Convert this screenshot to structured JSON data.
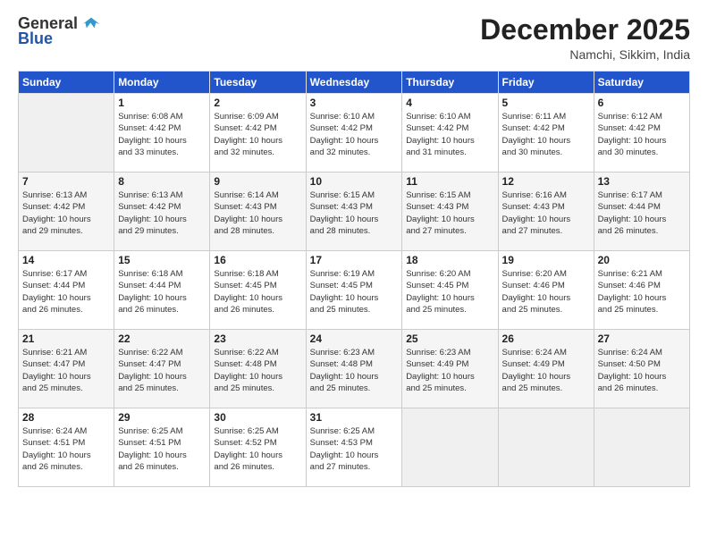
{
  "header": {
    "logo_general": "General",
    "logo_blue": "Blue",
    "month_title": "December 2025",
    "subtitle": "Namchi, Sikkim, India"
  },
  "days_of_week": [
    "Sunday",
    "Monday",
    "Tuesday",
    "Wednesday",
    "Thursday",
    "Friday",
    "Saturday"
  ],
  "weeks": [
    [
      {
        "day": "",
        "info": ""
      },
      {
        "day": "1",
        "info": "Sunrise: 6:08 AM\nSunset: 4:42 PM\nDaylight: 10 hours\nand 33 minutes."
      },
      {
        "day": "2",
        "info": "Sunrise: 6:09 AM\nSunset: 4:42 PM\nDaylight: 10 hours\nand 32 minutes."
      },
      {
        "day": "3",
        "info": "Sunrise: 6:10 AM\nSunset: 4:42 PM\nDaylight: 10 hours\nand 32 minutes."
      },
      {
        "day": "4",
        "info": "Sunrise: 6:10 AM\nSunset: 4:42 PM\nDaylight: 10 hours\nand 31 minutes."
      },
      {
        "day": "5",
        "info": "Sunrise: 6:11 AM\nSunset: 4:42 PM\nDaylight: 10 hours\nand 30 minutes."
      },
      {
        "day": "6",
        "info": "Sunrise: 6:12 AM\nSunset: 4:42 PM\nDaylight: 10 hours\nand 30 minutes."
      }
    ],
    [
      {
        "day": "7",
        "info": "Sunrise: 6:13 AM\nSunset: 4:42 PM\nDaylight: 10 hours\nand 29 minutes."
      },
      {
        "day": "8",
        "info": "Sunrise: 6:13 AM\nSunset: 4:42 PM\nDaylight: 10 hours\nand 29 minutes."
      },
      {
        "day": "9",
        "info": "Sunrise: 6:14 AM\nSunset: 4:43 PM\nDaylight: 10 hours\nand 28 minutes."
      },
      {
        "day": "10",
        "info": "Sunrise: 6:15 AM\nSunset: 4:43 PM\nDaylight: 10 hours\nand 28 minutes."
      },
      {
        "day": "11",
        "info": "Sunrise: 6:15 AM\nSunset: 4:43 PM\nDaylight: 10 hours\nand 27 minutes."
      },
      {
        "day": "12",
        "info": "Sunrise: 6:16 AM\nSunset: 4:43 PM\nDaylight: 10 hours\nand 27 minutes."
      },
      {
        "day": "13",
        "info": "Sunrise: 6:17 AM\nSunset: 4:44 PM\nDaylight: 10 hours\nand 26 minutes."
      }
    ],
    [
      {
        "day": "14",
        "info": "Sunrise: 6:17 AM\nSunset: 4:44 PM\nDaylight: 10 hours\nand 26 minutes."
      },
      {
        "day": "15",
        "info": "Sunrise: 6:18 AM\nSunset: 4:44 PM\nDaylight: 10 hours\nand 26 minutes."
      },
      {
        "day": "16",
        "info": "Sunrise: 6:18 AM\nSunset: 4:45 PM\nDaylight: 10 hours\nand 26 minutes."
      },
      {
        "day": "17",
        "info": "Sunrise: 6:19 AM\nSunset: 4:45 PM\nDaylight: 10 hours\nand 25 minutes."
      },
      {
        "day": "18",
        "info": "Sunrise: 6:20 AM\nSunset: 4:45 PM\nDaylight: 10 hours\nand 25 minutes."
      },
      {
        "day": "19",
        "info": "Sunrise: 6:20 AM\nSunset: 4:46 PM\nDaylight: 10 hours\nand 25 minutes."
      },
      {
        "day": "20",
        "info": "Sunrise: 6:21 AM\nSunset: 4:46 PM\nDaylight: 10 hours\nand 25 minutes."
      }
    ],
    [
      {
        "day": "21",
        "info": "Sunrise: 6:21 AM\nSunset: 4:47 PM\nDaylight: 10 hours\nand 25 minutes."
      },
      {
        "day": "22",
        "info": "Sunrise: 6:22 AM\nSunset: 4:47 PM\nDaylight: 10 hours\nand 25 minutes."
      },
      {
        "day": "23",
        "info": "Sunrise: 6:22 AM\nSunset: 4:48 PM\nDaylight: 10 hours\nand 25 minutes."
      },
      {
        "day": "24",
        "info": "Sunrise: 6:23 AM\nSunset: 4:48 PM\nDaylight: 10 hours\nand 25 minutes."
      },
      {
        "day": "25",
        "info": "Sunrise: 6:23 AM\nSunset: 4:49 PM\nDaylight: 10 hours\nand 25 minutes."
      },
      {
        "day": "26",
        "info": "Sunrise: 6:24 AM\nSunset: 4:49 PM\nDaylight: 10 hours\nand 25 minutes."
      },
      {
        "day": "27",
        "info": "Sunrise: 6:24 AM\nSunset: 4:50 PM\nDaylight: 10 hours\nand 26 minutes."
      }
    ],
    [
      {
        "day": "28",
        "info": "Sunrise: 6:24 AM\nSunset: 4:51 PM\nDaylight: 10 hours\nand 26 minutes."
      },
      {
        "day": "29",
        "info": "Sunrise: 6:25 AM\nSunset: 4:51 PM\nDaylight: 10 hours\nand 26 minutes."
      },
      {
        "day": "30",
        "info": "Sunrise: 6:25 AM\nSunset: 4:52 PM\nDaylight: 10 hours\nand 26 minutes."
      },
      {
        "day": "31",
        "info": "Sunrise: 6:25 AM\nSunset: 4:53 PM\nDaylight: 10 hours\nand 27 minutes."
      },
      {
        "day": "",
        "info": ""
      },
      {
        "day": "",
        "info": ""
      },
      {
        "day": "",
        "info": ""
      }
    ]
  ]
}
